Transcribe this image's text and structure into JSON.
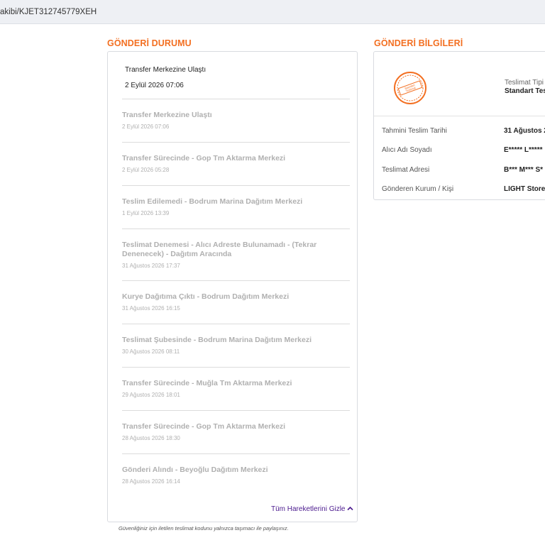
{
  "url": {
    "text": "akibi/KJET312745779XEH"
  },
  "status": {
    "title": "GÖNDERİ DURUMU",
    "current": {
      "title": "Transfer Merkezine Ulaştı",
      "date": "2 Eylül 2026 07:06"
    },
    "events": [
      {
        "title": "Transfer Merkezine Ulaştı",
        "date": "2 Eylül 2026 07:06"
      },
      {
        "title": "Transfer Sürecinde - Gop Tm Aktarma Merkezi",
        "date": "2 Eylül 2026 05:28"
      },
      {
        "title": "Teslim Edilemedi - Bodrum Marina Dağıtım Merkezi",
        "date": "1 Eylül 2026 13:39"
      },
      {
        "title": "Teslimat Denemesi - Alıcı Adreste Bulunamadı - (Tekrar Denenecek) - Dağıtım Aracında",
        "date": "31 Ağustos 2026 17:37"
      },
      {
        "title": "Kurye Dağıtıma Çıktı - Bodrum Dağıtım Merkezi",
        "date": "31 Ağustos 2026 16:15"
      },
      {
        "title": "Teslimat Şubesinde - Bodrum Marina Dağıtım Merkezi",
        "date": "30 Ağustos 2026 08:11"
      },
      {
        "title": "Transfer Sürecinde - Muğla Tm Aktarma Merkezi",
        "date": "29 Ağustos 2026 18:01"
      },
      {
        "title": "Transfer Sürecinde - Gop Tm Aktarma Merkezi",
        "date": "28 Ağustos 2026 18:30"
      },
      {
        "title": "Gönderi Alındı - Beyoğlu Dağıtım Merkezi",
        "date": "28 Ağustos 2026 16:14"
      }
    ],
    "toggle_label": "Tüm Hareketlerini Gizle",
    "toggle_icon": "chevron-up-icon",
    "disclaimer": "Güvenliğiniz için iletilen teslimat kodunu yalnızca taşımacı ile paylaşınız."
  },
  "info": {
    "title": "GÖNDERİ BİLGİLERİ",
    "stamp_text": "Standart Teslimat",
    "delivery_type_label": "Teslimat Tipi",
    "delivery_type_value": "Standart Tes",
    "rows": [
      {
        "label": "Tahmini Teslim Tarihi",
        "value": "31 Ağustos 2"
      },
      {
        "label": "Alıcı Adı Soyadı",
        "value": "E***** L*****"
      },
      {
        "label": "Teslimat Adresi",
        "value": "B*** M*** S*"
      },
      {
        "label": "Gönderen Kurum / Kişi",
        "value": "LIGHT Store"
      }
    ]
  },
  "colors": {
    "accent": "#f36f21",
    "link": "#4b1a8e",
    "muted_text": "#b0b0b0"
  }
}
